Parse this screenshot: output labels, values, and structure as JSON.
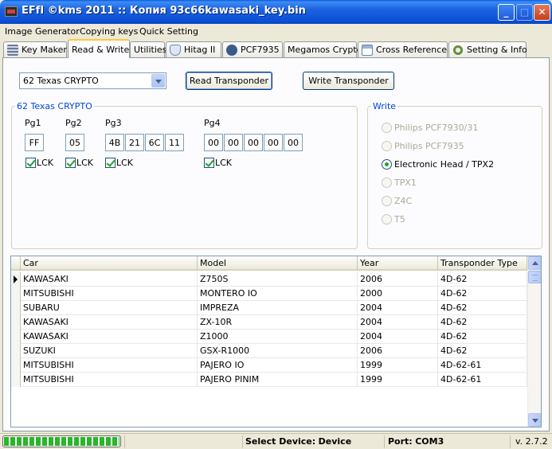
{
  "window": {
    "title": "EFfI   ©kms 2011 :: Копия 93c66kawasaki_key.bin",
    "minimize_glyph": "_",
    "maximize_glyph": "□",
    "close_glyph": "✕"
  },
  "menu": [
    "Image Generator",
    "Copying keys",
    "Quick Setting"
  ],
  "tabs": [
    {
      "label": "Key Maker",
      "icon": "calculator-icon"
    },
    {
      "label": "Read & Write",
      "icon": ""
    },
    {
      "label": "Utilities",
      "icon": ""
    },
    {
      "label": "Hitag II",
      "icon": "philips-shield-icon"
    },
    {
      "label": "PCF7935",
      "icon": "pcf-icon"
    },
    {
      "label": "Megamos Crypto",
      "icon": ""
    },
    {
      "label": "Cross Reference",
      "icon": "table-add-icon"
    },
    {
      "label": "Setting & Info",
      "icon": "gear-icon"
    }
  ],
  "active_tab": "Read & Write",
  "transponder_select": {
    "value": "62 Texas CRYPTO"
  },
  "buttons": {
    "read": "Read Transponder",
    "write": "Write Transponder"
  },
  "crypto_group": {
    "title": "62 Texas CRYPTO",
    "lck_label": "LCK",
    "pages": [
      {
        "label": "Pg1",
        "bytes": [
          "FF"
        ],
        "locked": true
      },
      {
        "label": "Pg2",
        "bytes": [
          "05"
        ],
        "locked": true
      },
      {
        "label": "Pg3",
        "bytes": [
          "4B",
          "21",
          "6C",
          "11"
        ],
        "locked": true
      },
      {
        "label": "Pg4",
        "bytes": [
          "00",
          "00",
          "00",
          "00",
          "00"
        ],
        "locked": true
      }
    ]
  },
  "write_group": {
    "title": "Write",
    "options": [
      {
        "label": "Philips PCF7930/31",
        "enabled": false,
        "selected": false
      },
      {
        "label": "Philips PCF7935",
        "enabled": false,
        "selected": false
      },
      {
        "label": "Electronic Head / TPX2",
        "enabled": true,
        "selected": true
      },
      {
        "label": "TPX1",
        "enabled": false,
        "selected": false
      },
      {
        "label": "Z4C",
        "enabled": false,
        "selected": false
      },
      {
        "label": "T5",
        "enabled": false,
        "selected": false
      }
    ]
  },
  "table": {
    "columns": [
      "Car",
      "Model",
      "Year",
      "Transponder Type"
    ],
    "rows": [
      [
        "KAWASAKI",
        "Z750S",
        "2006",
        "4D-62"
      ],
      [
        "MITSUBISHI",
        "MONTERO IO",
        "2000",
        "4D-62"
      ],
      [
        "SUBARU",
        "IMPREZA",
        "2004",
        "4D-62"
      ],
      [
        "KAWASAKI",
        "ZX-10R",
        "2004",
        "4D-62"
      ],
      [
        "KAWASAKI",
        "Z1000",
        "2004",
        "4D-62"
      ],
      [
        "SUZUKI",
        "GSX-R1000",
        "2006",
        "4D-62"
      ],
      [
        "MITSUBISHI",
        "PAJERO IO",
        "1999",
        "4D-62-61"
      ],
      [
        "MITSUBISHI",
        "PAJERO PINIM",
        "1999",
        "4D-62-61"
      ]
    ],
    "current_row": 0
  },
  "status": {
    "progress_fraction": 1.0,
    "device_label": "Select Device:",
    "device_value": "Device",
    "port_label": "Port:",
    "port_value": "COM3",
    "version": "v. 2.7.2"
  }
}
